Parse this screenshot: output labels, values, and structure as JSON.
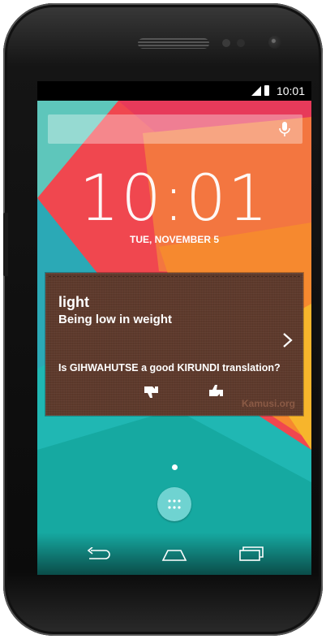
{
  "status_bar": {
    "time": "10:01",
    "signal_icon": "signal-icon",
    "battery_icon": "battery-icon"
  },
  "search": {
    "mic_icon": "mic-icon"
  },
  "lockscreen": {
    "clock": "10:01",
    "date": "TUE, NOVEMBER 5"
  },
  "widget": {
    "word": "light",
    "definition": "Being low in weight",
    "question": "Is GIHWAHUTSE a good KIRUNDI translation?",
    "brand": "Kamusi.org",
    "next_icon": "chevron-right-icon",
    "thumbs_down_icon": "thumbs-down-icon",
    "thumbs_up_icon": "thumbs-up-icon"
  },
  "navigation": {
    "back_icon": "back-icon",
    "home_icon": "home-icon",
    "recents_icon": "recents-icon",
    "apps_icon": "apps-grid-icon"
  },
  "colors": {
    "widget_bg": "#5e3a2c",
    "apps_button": "#6fd3d1",
    "wallpaper_teal": "#1fb9b0",
    "wallpaper_red": "#f0474f",
    "wallpaper_orange": "#f6892f"
  }
}
